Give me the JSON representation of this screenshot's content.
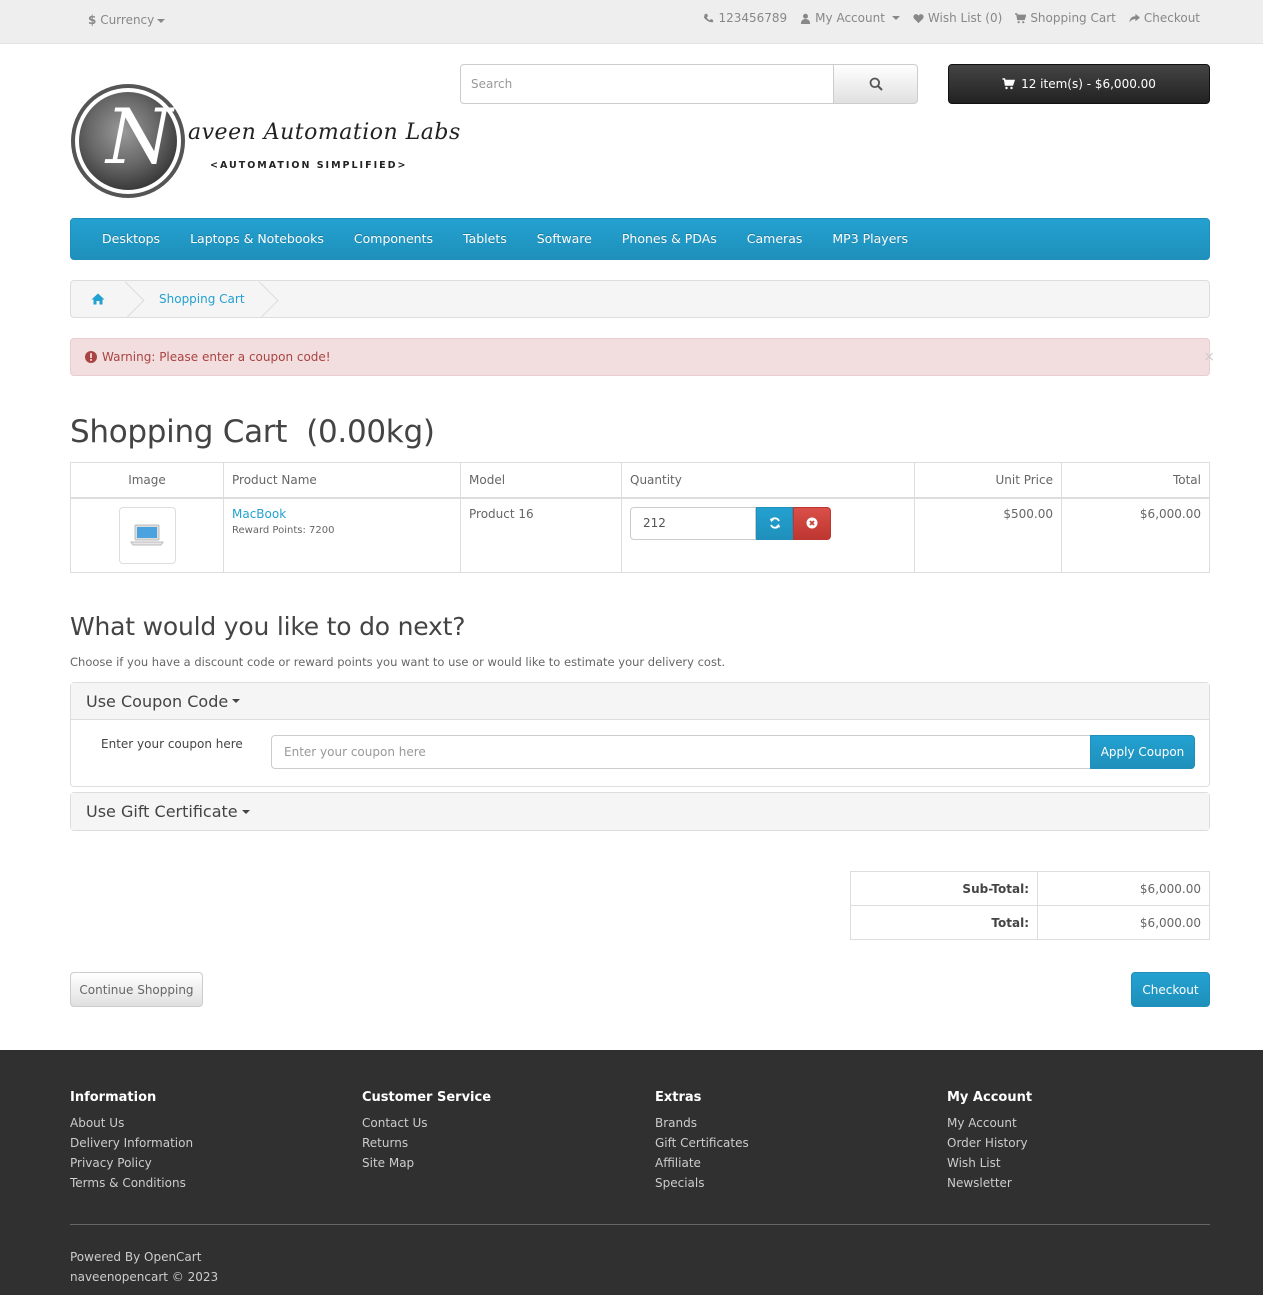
{
  "topbar": {
    "currency_symbol": "$",
    "currency_label": "Currency",
    "phone": "123456789",
    "my_account": "My Account",
    "wish_list": "Wish List (0)",
    "shopping_cart": "Shopping Cart",
    "checkout": "Checkout"
  },
  "header": {
    "logo_text": "aveen Automation Labs",
    "logo_tagline": "<AUTOMATION SIMPLIFIED>",
    "logo_letter": "N",
    "search_placeholder": "Search",
    "cart_button": "12 item(s) - $6,000.00"
  },
  "menu": [
    "Desktops",
    "Laptops & Notebooks",
    "Components",
    "Tablets",
    "Software",
    "Phones & PDAs",
    "Cameras",
    "MP3 Players"
  ],
  "breadcrumb": {
    "current": "Shopping Cart"
  },
  "alert": {
    "text": "Warning: Please enter a coupon code!",
    "close": "×"
  },
  "page_title": "Shopping Cart  (0.00kg)",
  "cart_table": {
    "headers": [
      "Image",
      "Product Name",
      "Model",
      "Quantity",
      "Unit Price",
      "Total"
    ],
    "rows": [
      {
        "name": "MacBook",
        "reward": "Reward Points: 7200",
        "model": "Product 16",
        "quantity": "212",
        "unit_price": "$500.00",
        "total": "$6,000.00"
      }
    ]
  },
  "next": {
    "title": "What would you like to do next?",
    "description": "Choose if you have a discount code or reward points you want to use or would like to estimate your delivery cost."
  },
  "coupon": {
    "heading": "Use Coupon Code",
    "label": "Enter your coupon here",
    "placeholder": "Enter your coupon here",
    "button": "Apply Coupon"
  },
  "gift": {
    "heading": "Use Gift Certificate"
  },
  "totals": [
    {
      "label": "Sub-Total:",
      "value": "$6,000.00"
    },
    {
      "label": "Total:",
      "value": "$6,000.00"
    }
  ],
  "buttons": {
    "continue": "Continue Shopping",
    "checkout": "Checkout"
  },
  "footer": {
    "columns": [
      {
        "title": "Information",
        "links": [
          "About Us",
          "Delivery Information",
          "Privacy Policy",
          "Terms & Conditions"
        ]
      },
      {
        "title": "Customer Service",
        "links": [
          "Contact Us",
          "Returns",
          "Site Map"
        ]
      },
      {
        "title": "Extras",
        "links": [
          "Brands",
          "Gift Certificates",
          "Affiliate",
          "Specials"
        ]
      },
      {
        "title": "My Account",
        "links": [
          "My Account",
          "Order History",
          "Wish List",
          "Newsletter"
        ]
      }
    ],
    "powered_prefix": "Powered By",
    "powered_link": "OpenCart",
    "copyright": "naveenopencart © 2023"
  },
  "colors": {
    "primary": "#23a1d1",
    "danger": "#da4f49",
    "dark": "#303030",
    "alert_bg": "#f2dede"
  }
}
